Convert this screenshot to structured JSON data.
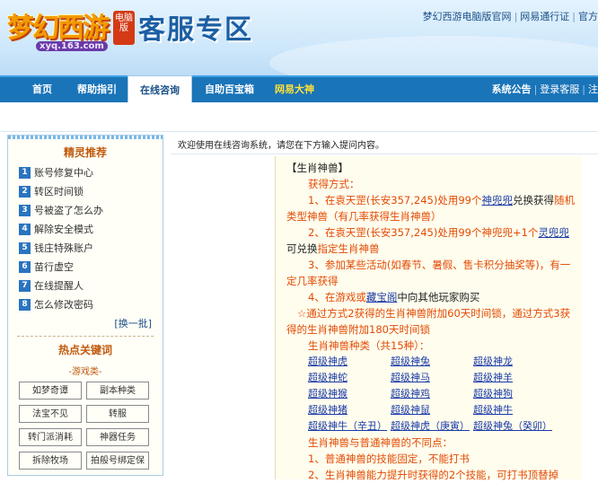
{
  "header": {
    "logo_text": "梦幻西游",
    "logo_badge": "电脑版",
    "logo_domain": "xyq.163.com",
    "section_title": "客服专区",
    "top_links": [
      "梦幻西游电脑版官网",
      "网易通行证",
      "官方"
    ]
  },
  "nav": {
    "items": [
      {
        "label": "首页"
      },
      {
        "label": "帮助指引"
      },
      {
        "label": "在线咨询"
      },
      {
        "label": "自助百宝箱"
      },
      {
        "label": "网易大神"
      }
    ],
    "right_links": [
      "系统公告",
      "登录客服",
      "注"
    ]
  },
  "sidebar": {
    "jl_title": "精灵推荐",
    "jl_items": [
      {
        "num": "1",
        "label": "账号修复中心"
      },
      {
        "num": "2",
        "label": "转区时间锁"
      },
      {
        "num": "3",
        "label": "号被盗了怎么办"
      },
      {
        "num": "4",
        "label": "解除安全模式"
      },
      {
        "num": "5",
        "label": "钱庄特殊账户"
      },
      {
        "num": "6",
        "label": "苗行虚空"
      },
      {
        "num": "7",
        "label": "在线提醒人"
      },
      {
        "num": "8",
        "label": "怎么修改密码"
      }
    ],
    "swap_label": "[换一批]",
    "hot_title": "热点关键词",
    "hot_subtitle": "-游戏类-",
    "keywords": [
      "如梦奇谭",
      "副本种类",
      "法宝不见",
      "转服",
      "转门派消耗",
      "神器任务",
      "拆除牧场",
      "拍般号绑定保"
    ]
  },
  "main": {
    "welcome": "欢迎使用在线咨询系统，请您在下方输入提问内容。",
    "answer": {
      "title": "【生肖神兽】",
      "get_way": "获得方式：",
      "l1a": "1、在袁天罡(长安357,245)处用99个",
      "l1_link": "神兜兜",
      "l1b": "兑换获得",
      "l1c": "随机类型神兽（有几率获得生肖神兽）",
      "l2a": "2、在袁天罡(长安357,245)处用99个神兜兜+1个",
      "l2_link": "灵兜兜",
      "l2b": "可兑换",
      "l2c": "指定生肖神兽",
      "l3": "3、参加某些活动(如春节、暑假、售卡积分抽奖等)，有一定几率获得",
      "l4a": "4、在游戏或",
      "l4_link": "藏宝阁",
      "l4b": "中向其他玩家购买",
      "note": "☆通过方式2获得的生肖神兽附加60天时间锁，通过方式3获得的生肖神兽附加180天时间锁",
      "kinds": "生肖神兽种类（共15种）：",
      "pets": [
        "超级神虎",
        "超级神兔",
        "超级神龙",
        "超级神蛇",
        "超级神马",
        "超级神羊",
        "超级神猴",
        "超级神鸡",
        "超级神狗",
        "超级神猪",
        "超级神鼠",
        "超级神牛",
        "超级神牛（辛丑）",
        "超级神虎（庚寅）",
        "超级神兔（癸卯）"
      ],
      "diff": "生肖神兽与普通神兽的不同点：",
      "d1": "1、普通神兽的技能固定，不能打书",
      "d2": "2、生肖神兽能力提升时获得的2个技能，可打书顶替掉"
    }
  }
}
